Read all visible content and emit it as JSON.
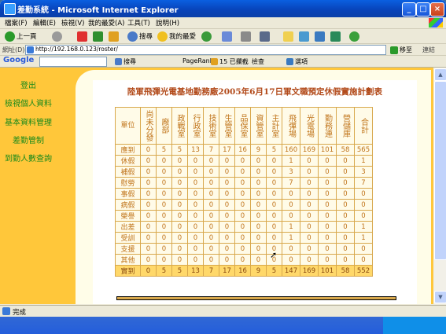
{
  "window": {
    "title": "差勤系統 - Microsoft Internet Explorer"
  },
  "menu": [
    "檔案(F)",
    "編輯(E)",
    "檢視(V)",
    "我的最愛(A)",
    "工具(T)",
    "說明(H)"
  ],
  "toolbar": {
    "back": "上一頁",
    "search": "搜尋",
    "favorites": "我的最愛"
  },
  "address": {
    "label": "網址(D)",
    "url": "http://192.168.0.123/roster/",
    "go": "移至",
    "links": "連結"
  },
  "google": {
    "logo": "Google",
    "search": "搜尋",
    "pagerank": "PageRank",
    "blocked": "15 已攔截",
    "check": "檢查",
    "options": "選項"
  },
  "sidebar": {
    "items": [
      "登出",
      "檢視個人資料",
      "基本資料管理",
      "差勤管制",
      "到勤人數查詢"
    ]
  },
  "page": {
    "title": "陸軍飛彈光電基地勤務廠2005年6月17日軍文職預定休假實施計劃表"
  },
  "table": {
    "corner": "單位",
    "columns": [
      "尚未分發",
      "廠部",
      "政戰室",
      "行政室",
      "技術室",
      "生管室",
      "品保室",
      "資管室",
      "主計室",
      "飛彈場",
      "光電場",
      "勤務連",
      "營儲庫",
      "合計"
    ],
    "rows": [
      {
        "label": "應到",
        "values": [
          "0",
          "5",
          "5",
          "13",
          "7",
          "17",
          "16",
          "9",
          "5",
          "160",
          "169",
          "101",
          "58",
          "565"
        ]
      },
      {
        "label": "休假",
        "values": [
          "0",
          "0",
          "0",
          "0",
          "0",
          "0",
          "0",
          "0",
          "0",
          "1",
          "0",
          "0",
          "0",
          "1"
        ]
      },
      {
        "label": "補假",
        "values": [
          "0",
          "0",
          "0",
          "0",
          "0",
          "0",
          "0",
          "0",
          "0",
          "3",
          "0",
          "0",
          "0",
          "3"
        ]
      },
      {
        "label": "慰勞",
        "values": [
          "0",
          "0",
          "0",
          "0",
          "0",
          "0",
          "0",
          "0",
          "0",
          "7",
          "0",
          "0",
          "0",
          "7"
        ]
      },
      {
        "label": "事假",
        "values": [
          "0",
          "0",
          "0",
          "0",
          "0",
          "0",
          "0",
          "0",
          "0",
          "0",
          "0",
          "0",
          "0",
          "0"
        ]
      },
      {
        "label": "病假",
        "values": [
          "0",
          "0",
          "0",
          "0",
          "0",
          "0",
          "0",
          "0",
          "0",
          "0",
          "0",
          "0",
          "0",
          "0"
        ]
      },
      {
        "label": "榮譽",
        "values": [
          "0",
          "0",
          "0",
          "0",
          "0",
          "0",
          "0",
          "0",
          "0",
          "0",
          "0",
          "0",
          "0",
          "0"
        ]
      },
      {
        "label": "出差",
        "values": [
          "0",
          "0",
          "0",
          "0",
          "0",
          "0",
          "0",
          "0",
          "0",
          "1",
          "0",
          "0",
          "0",
          "1"
        ]
      },
      {
        "label": "受訓",
        "values": [
          "0",
          "0",
          "0",
          "0",
          "0",
          "0",
          "0",
          "0",
          "0",
          "1",
          "0",
          "0",
          "0",
          "1"
        ]
      },
      {
        "label": "支援",
        "values": [
          "0",
          "0",
          "0",
          "0",
          "0",
          "0",
          "0",
          "0",
          "0",
          "0",
          "0",
          "0",
          "0",
          "0"
        ]
      },
      {
        "label": "其他",
        "values": [
          "0",
          "0",
          "0",
          "0",
          "0",
          "0",
          "0",
          "0",
          "0",
          "0",
          "0",
          "0",
          "0",
          "0"
        ]
      }
    ],
    "total": {
      "label": "實到",
      "values": [
        "0",
        "5",
        "5",
        "13",
        "7",
        "17",
        "16",
        "9",
        "5",
        "147",
        "169",
        "101",
        "58",
        "552"
      ]
    }
  },
  "status": {
    "text": "完成"
  }
}
